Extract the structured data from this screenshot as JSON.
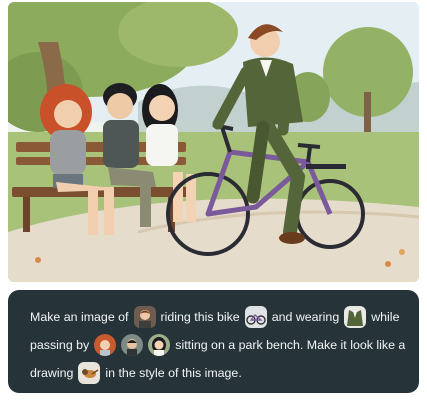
{
  "prompt": {
    "line1": {
      "a": "Make an image of",
      "b": "riding this bike",
      "c": "and wearing",
      "d": "while"
    },
    "line2": {
      "a": "passing by",
      "b": "sitting on a park bench. Make it look like a"
    },
    "line3": {
      "a": "drawing",
      "b": "in the style of this image."
    }
  },
  "colors": {
    "card_background": "#26343a",
    "bike_frame": "#7a5a9a",
    "suit": "#55653a"
  },
  "icons": {
    "person_thumb": "boy-portrait",
    "bike_thumb": "bicycle",
    "suit_thumb": "green-suit",
    "friend_thumbs": [
      "red-haired-girl",
      "dark-haired-boy",
      "dark-haired-girl"
    ],
    "style_thumb": "bird-watercolor"
  }
}
